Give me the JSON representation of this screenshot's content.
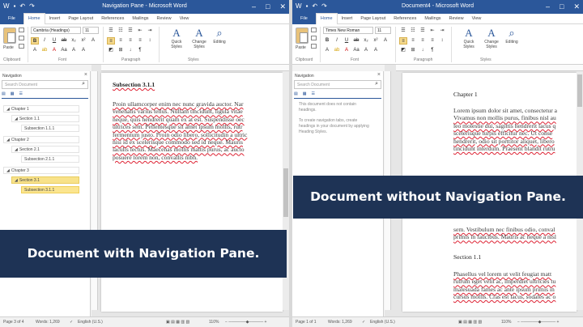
{
  "left_window": {
    "title": "Navigation Pane - Microsoft Word",
    "tabs": [
      "File",
      "Home",
      "Insert",
      "Page Layout",
      "References",
      "Mailings",
      "Review",
      "View"
    ],
    "font_name": "Cambria (Headings)",
    "font_size": "11",
    "ribbon_groups": [
      "Clipboard",
      "Font",
      "Paragraph",
      "Styles"
    ],
    "paste_label": "Paste",
    "quick_styles": "Quick Styles",
    "change_styles": "Change Styles",
    "editing": "Editing",
    "nav_title": "Navigation",
    "nav_search_placeholder": "Search Document",
    "headings": [
      {
        "text": "Chapter 1",
        "level": 1
      },
      {
        "text": "Section 1.1",
        "level": 2
      },
      {
        "text": "Subsection 1.1.1",
        "level": 3
      },
      {
        "text": "Chapter 2",
        "level": 1
      },
      {
        "text": "Section 2.1",
        "level": 2
      },
      {
        "text": "Subsection 2.1.1",
        "level": 3
      },
      {
        "text": "Chapter 3",
        "level": 1
      },
      {
        "text": "Section 3.1",
        "level": 2
      },
      {
        "text": "Subsection 3.1.1",
        "level": 3
      }
    ],
    "doc_heading": "Subsection 3.1.1",
    "doc_lines": [
      "Proin ullamcorper enim nec nunc gravida auctor. Nar",
      "venenatis varius tellus. Nullam tincidunt, ligula vitae",
      "neque, quis hendrerit quam ex at est. Suspendisse oec",
      "ultrices sem. Pellentesque sit amet ipsum mollis, rutr",
      "fermentum justo. Proin odio libero, sollicitudin a ultric",
      "nisi id ex scelerisque commodo sed id neque. Mauris",
      "iaculis lectus. Maecenas mollis mattis purus, ac aucto",
      "posuere lorem non, convallis nibh."
    ],
    "status": {
      "page": "Page 3 of 4",
      "words": "Words: 1,269",
      "language": "English (U.S.)",
      "zoom": "110%"
    }
  },
  "right_window": {
    "title": "Document4 - Microsoft Word",
    "tabs": [
      "File",
      "Home",
      "Insert",
      "Page Layout",
      "References",
      "Mailings",
      "Review",
      "View"
    ],
    "font_name": "Times New Roman",
    "font_size": "11",
    "ribbon_groups": [
      "Clipboard",
      "Font",
      "Paragraph",
      "Styles"
    ],
    "paste_label": "Paste",
    "quick_styles": "Quick Styles",
    "change_styles": "Change Styles",
    "editing": "Editing",
    "nav_title": "Navigation",
    "nav_search_placeholder": "Search Document",
    "nav_info_1": "This document does not contain headings.",
    "nav_info_2": "To create navigation tabs, create headings in your document by applying Heading Styles.",
    "doc_heading_1": "Chapter 1",
    "doc_lines_1": [
      "Lorem ipsum dolor sit amet, consectetur a",
      "Vivamus non mollis purus, finibus nisl au",
      "leo molestie dui, sagittis hendrerit lacus q",
      "scelerisque turpis efficitur nec. Ut conse",
      "hendrerit, odio sit porttitor aliquet, libero",
      "tincidunt interdum. Praesent blandit rutru"
    ],
    "doc_lines_2": [
      "sem. Vestibulum nec finibus odio, conval",
      "primis in faucibus. Mauris ac neque a nisl"
    ],
    "doc_heading_2": "Section 1.1",
    "doc_lines_3": [
      "Phasellus vel lorem ut velit feugiat matt",
      "rutrum eget velit ac, imperdiet ultricies tu",
      "malesuada fames ac ante ipsum primis in",
      "cursus mollis. Cras est lacus, sodales ac o"
    ],
    "status": {
      "page": "Page 1 of 1",
      "words": "Words: 1,269",
      "language": "English (U.S.)",
      "zoom": "110%"
    }
  },
  "banner_left": "Document with Navigation Pane.",
  "banner_right": "Document without Navigation Pane.",
  "colors": {
    "word_blue": "#2b579a",
    "banner_navy": "#1e3355",
    "highlight": "#f8e28a"
  }
}
